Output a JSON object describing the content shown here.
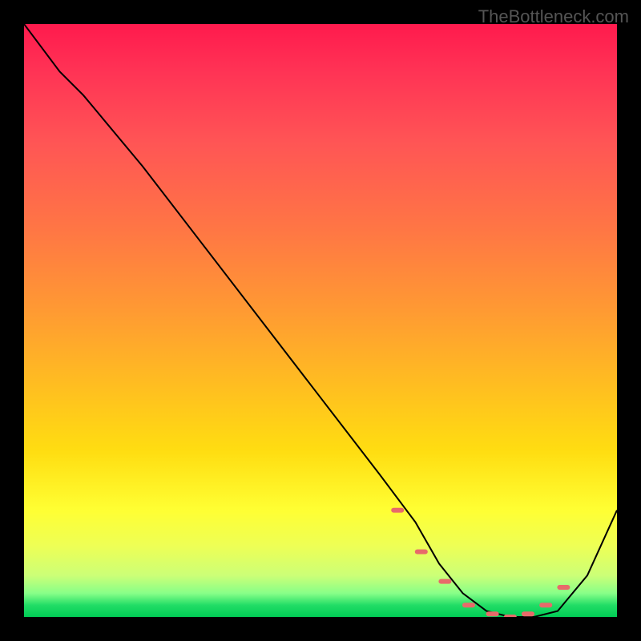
{
  "watermark": "TheBottleneck.com",
  "chart_data": {
    "type": "line",
    "title": "",
    "xlabel": "",
    "ylabel": "",
    "xlim": [
      0,
      100
    ],
    "ylim": [
      0,
      100
    ],
    "series": [
      {
        "name": "curve",
        "x": [
          0,
          6,
          10,
          20,
          30,
          40,
          50,
          60,
          66,
          70,
          74,
          78,
          82,
          86,
          90,
          95,
          100
        ],
        "values": [
          100,
          92,
          88,
          76,
          63,
          50,
          37,
          24,
          16,
          9,
          4,
          1,
          0,
          0,
          1,
          7,
          18
        ]
      }
    ],
    "markers": {
      "name": "pink-markers",
      "color": "#e86a6a",
      "x": [
        63,
        67,
        71,
        75,
        79,
        82,
        85,
        88,
        91
      ],
      "values": [
        18,
        11,
        6,
        2,
        0.5,
        0,
        0.5,
        2,
        5
      ]
    }
  }
}
